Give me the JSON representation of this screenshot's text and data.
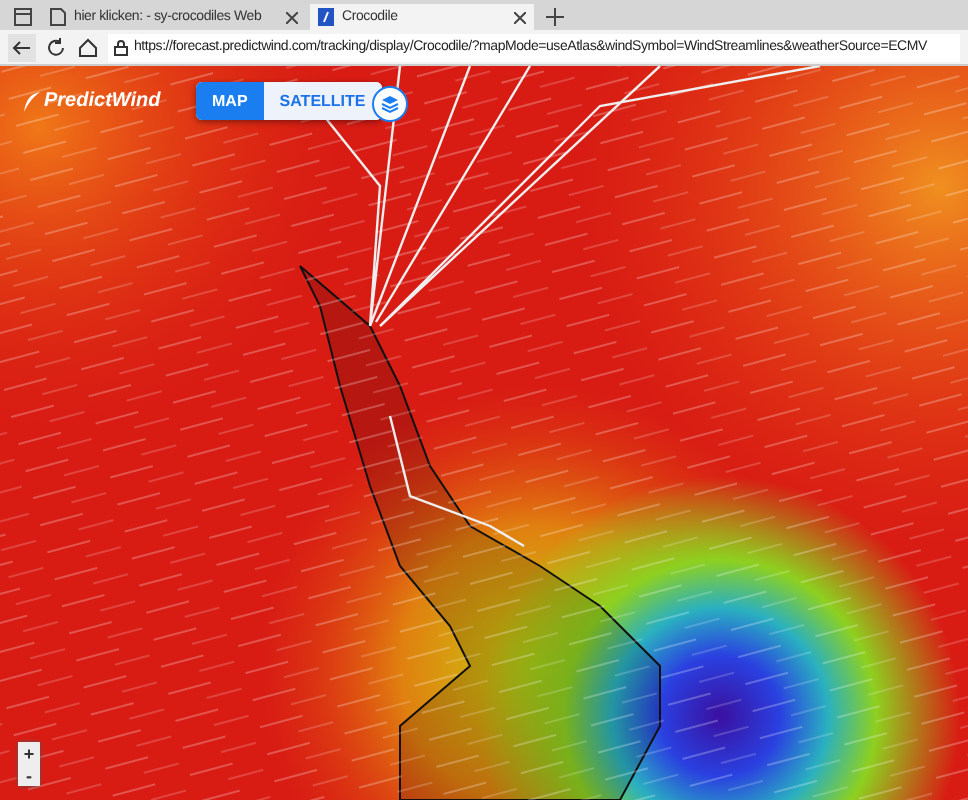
{
  "browser": {
    "tabs": [
      {
        "label": "hier klicken: - sy-crocodiles Web",
        "selected": false
      },
      {
        "label": "Crocodile",
        "selected": true
      }
    ],
    "url": "https://forecast.predictwind.com/tracking/display/Crocodile/?mapMode=useAtlas&windSymbol=WindStreamlines&weatherSource=ECMV"
  },
  "map": {
    "logo": "PredictWind",
    "modes": [
      {
        "label": "MAP",
        "selected": true
      },
      {
        "label": "SATELLITE",
        "selected": false
      }
    ],
    "zoom": [
      "+",
      "-"
    ]
  }
}
